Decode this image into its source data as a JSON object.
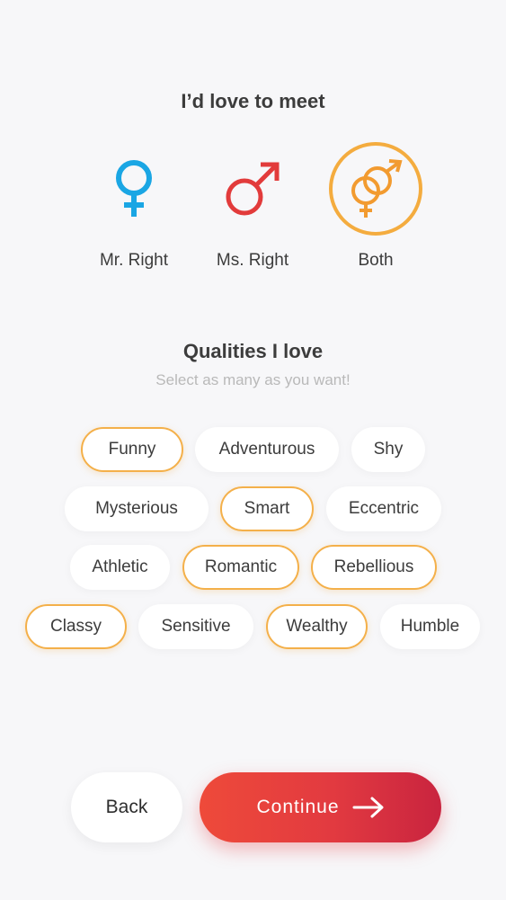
{
  "meet": {
    "title": "I’d love to meet",
    "options": [
      {
        "label": "Mr. Right",
        "icon": "female-symbol-icon",
        "color": "#1aa6e4",
        "selected": false
      },
      {
        "label": "Ms. Right",
        "icon": "male-symbol-icon",
        "color": "#e23b3b",
        "selected": false
      },
      {
        "label": "Both",
        "icon": "intertwined-gender-symbols-icon",
        "color": "#f29b30",
        "selected": true
      }
    ]
  },
  "qualities": {
    "title": "Qualities I love",
    "subtitle": "Select as many as you want!",
    "chips": [
      {
        "label": "Funny",
        "selected": true
      },
      {
        "label": "Adventurous",
        "selected": false
      },
      {
        "label": "Shy",
        "selected": false
      },
      {
        "label": "Mysterious",
        "selected": false
      },
      {
        "label": "Smart",
        "selected": true
      },
      {
        "label": "Eccentric",
        "selected": false
      },
      {
        "label": "Athletic",
        "selected": false
      },
      {
        "label": "Romantic",
        "selected": true
      },
      {
        "label": "Rebellious",
        "selected": true
      },
      {
        "label": "Classy",
        "selected": true
      },
      {
        "label": "Sensitive",
        "selected": false
      },
      {
        "label": "Wealthy",
        "selected": true
      },
      {
        "label": "Humble",
        "selected": false
      }
    ]
  },
  "footer": {
    "back_label": "Back",
    "continue_label": "Continue",
    "continue_icon": "arrow-right-icon"
  },
  "colors": {
    "accent_orange": "#f4ac3f",
    "continue_red": "#e23a40",
    "female_blue": "#1aa6e4",
    "male_red": "#e23b3b"
  }
}
